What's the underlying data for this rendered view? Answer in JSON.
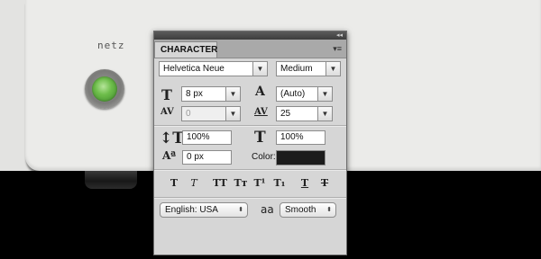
{
  "device": {
    "label": "netz"
  },
  "panel": {
    "collapse_icon": "◂◂",
    "tab_title": "CHARACTER",
    "menu_icon": "▾≡",
    "font_family": "Helvetica Neue",
    "font_style": "Medium",
    "font_size": "8 px",
    "leading": "(Auto)",
    "kerning": "0",
    "tracking": "25",
    "vertical_scale": "100%",
    "horizontal_scale": "100%",
    "baseline_shift": "0 px",
    "color_label": "Color:",
    "color_value": "#1c1c1c",
    "language": "English: USA",
    "antialias_icon": "aa",
    "antialias": "Smooth",
    "style_buttons": [
      {
        "glyph": "T",
        "name": "faux-bold"
      },
      {
        "glyph": "T",
        "name": "faux-italic"
      },
      {
        "glyph": "TT",
        "name": "all-caps"
      },
      {
        "glyph": "Tт",
        "name": "small-caps"
      },
      {
        "glyph": "T¹",
        "name": "superscript"
      },
      {
        "glyph": "T₁",
        "name": "subscript"
      },
      {
        "glyph": "T",
        "name": "underline"
      },
      {
        "glyph": "T",
        "name": "strikethrough"
      }
    ]
  }
}
